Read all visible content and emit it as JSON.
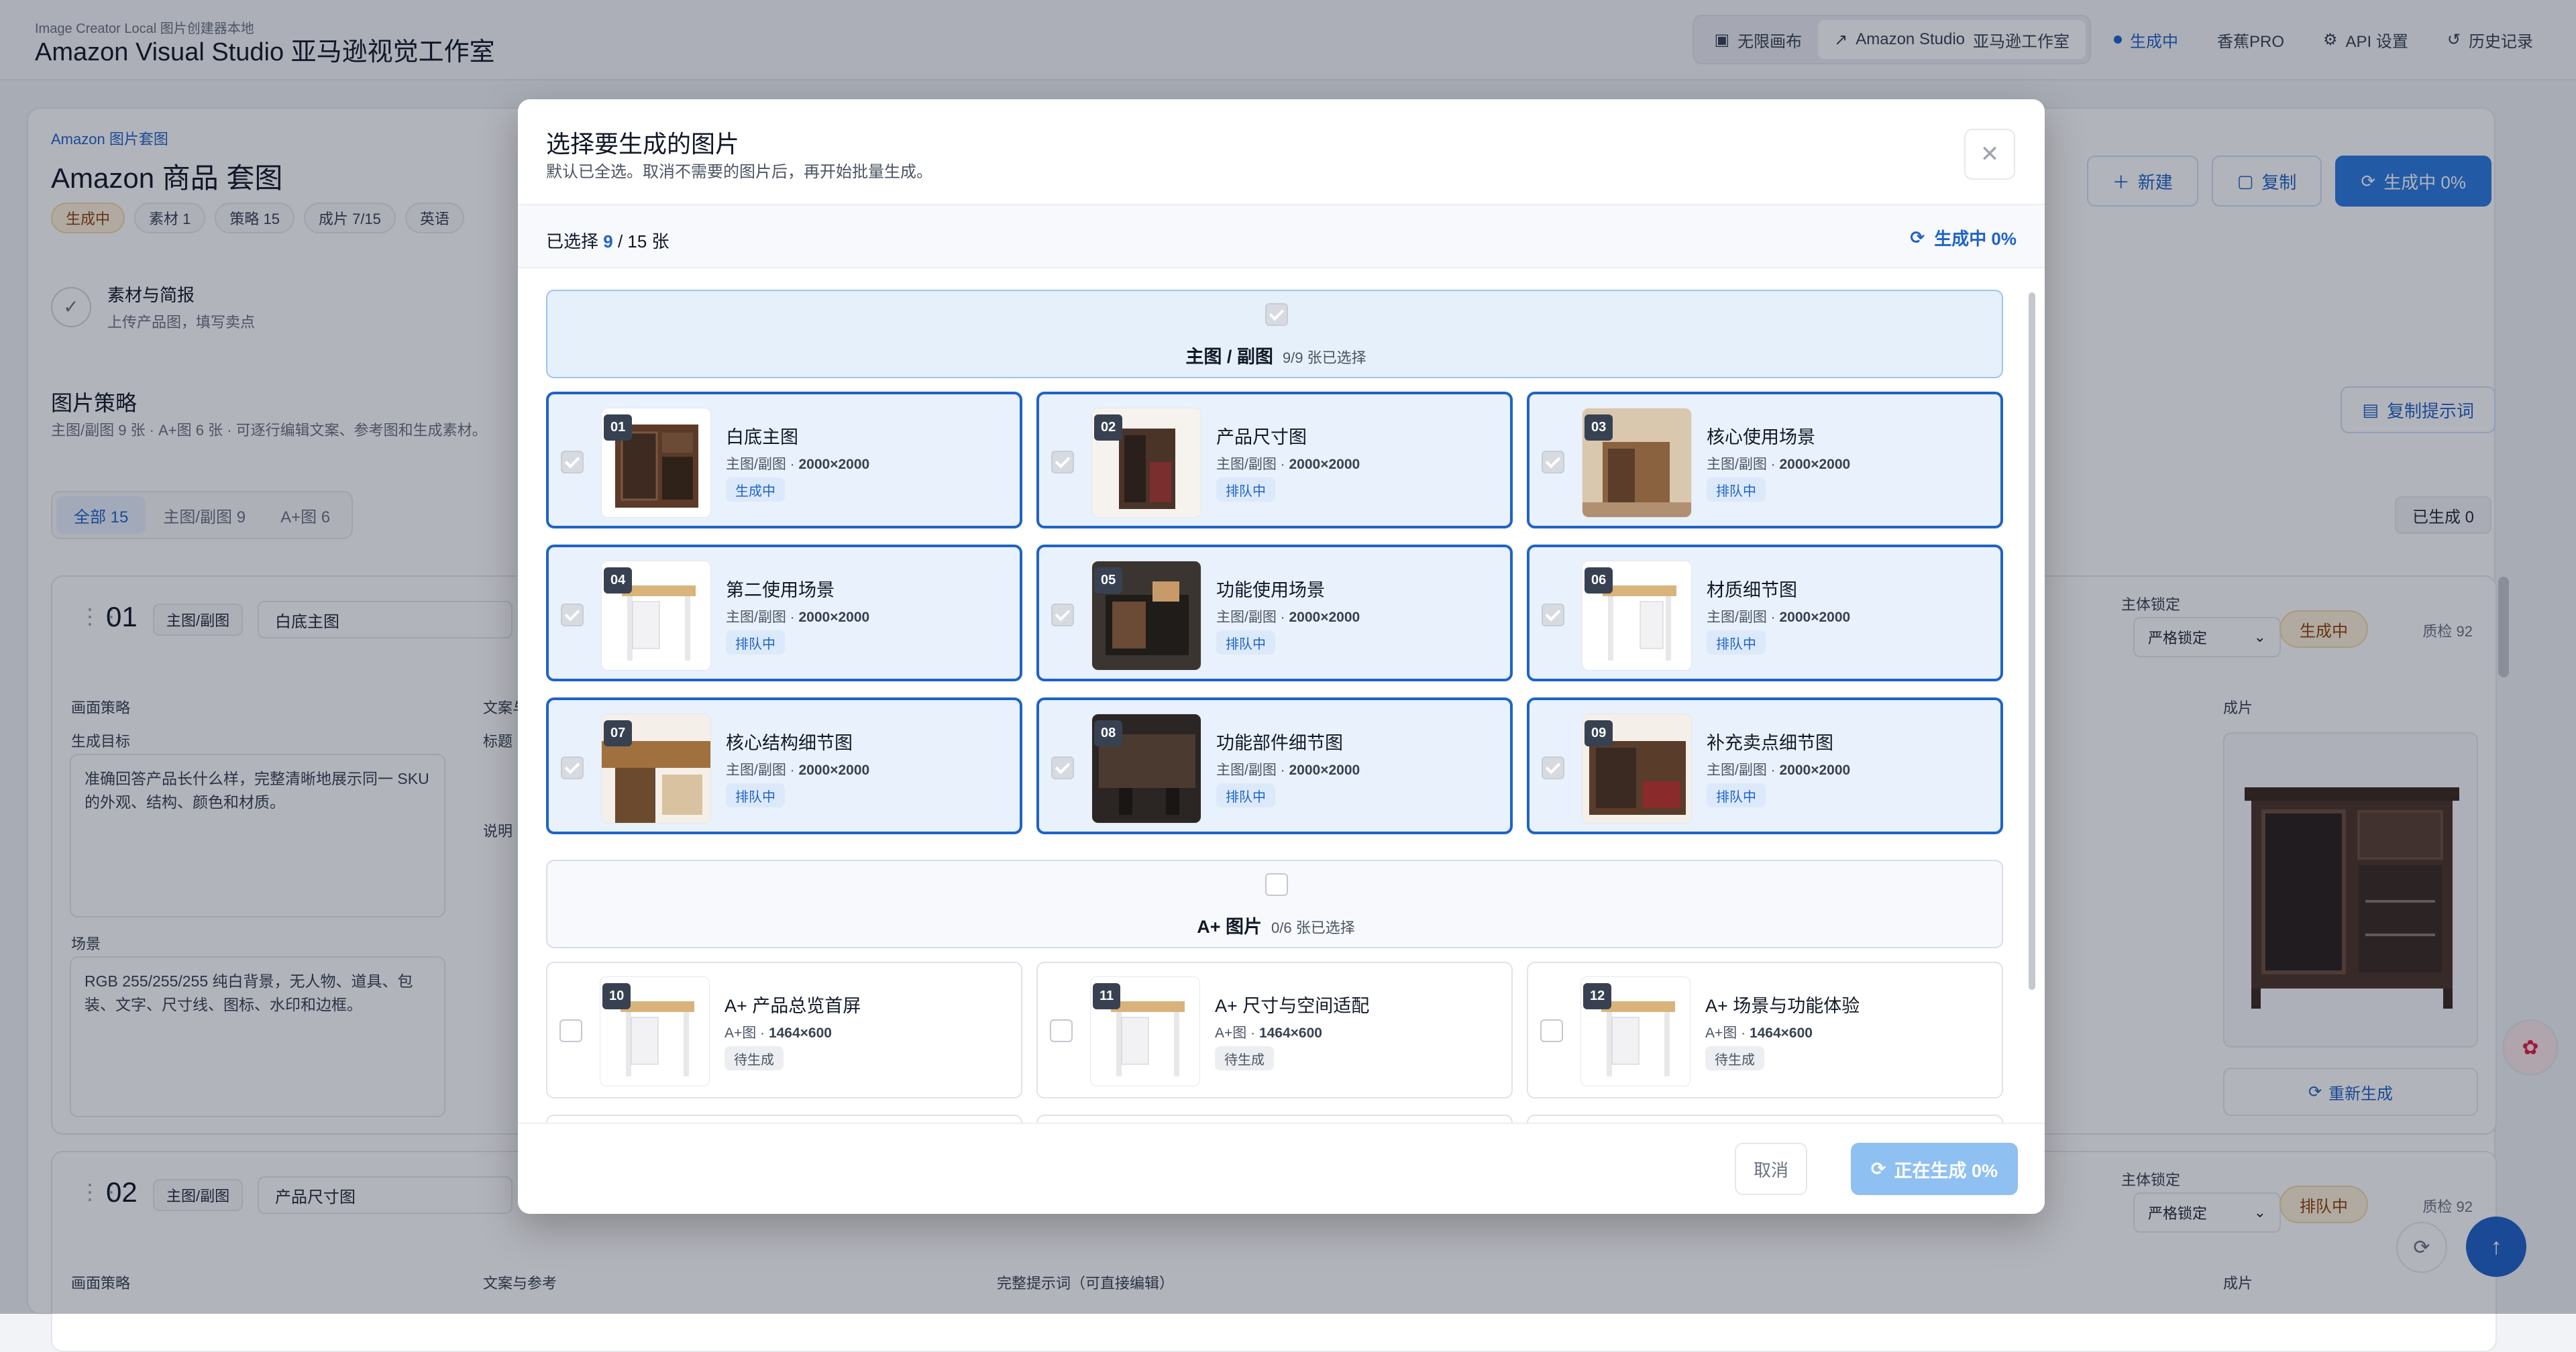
{
  "app": {
    "subtitle": "Image Creator Local 图片创建器本地",
    "title": "Amazon Visual Studio 亚马逊视觉工作室",
    "nav": {
      "canvas": "无限画布",
      "studio": "Amazon Studio",
      "studio_cn": "亚马逊工作室",
      "generating": "生成中",
      "banana": "香蕉PRO",
      "api": "API 设置",
      "history": "历史记录"
    }
  },
  "page": {
    "crumb": "Amazon 图片套图",
    "title": "Amazon 商品 套图",
    "chips": [
      "生成中",
      "素材 1",
      "策略 15",
      "成片 7/15",
      "英语"
    ],
    "buttons": {
      "new": "新建",
      "copy": "复制",
      "generating": "生成中 0%"
    },
    "step": {
      "title": "素材与简报",
      "sub": "上传产品图，填写卖点"
    },
    "strategy": {
      "title": "图片策略",
      "sub": "主图/副图 9 张 · A+图 6 张 · 可逐行编辑文案、参考图和生成素材。",
      "copy_prompt": "复制提示词",
      "filters": [
        "全部 15",
        "主图/副图 9",
        "A+图 6"
      ],
      "done": "已生成 0"
    },
    "cards": [
      {
        "num": "01",
        "tag": "主图/副图",
        "name": "白底主图",
        "lock_label": "主体锁定",
        "lock_value": "严格锁定",
        "status": "生成中",
        "qc": "质检 92"
      },
      {
        "num": "02",
        "tag": "主图/副图",
        "name": "产品尺寸图",
        "lock_label": "主体锁定",
        "lock_value": "严格锁定",
        "status": "排队中",
        "qc": "质检 92"
      }
    ],
    "card_fields": {
      "strategy": "画面策略",
      "goal": "生成目标",
      "goal_text": "准确回答产品长什么样，完整清晰地展示同一 SKU 的外观、结构、颜色和材质。",
      "scene": "场景",
      "scene_text": "RGB 255/255/255 纯白背景，无人物、道具、包装、文字、尺寸线、图标、水印和边框。",
      "copy_ref": "文案与参考",
      "title_lbl": "标题",
      "desc_lbl": "说明",
      "output": "成片",
      "regen": "重新生成",
      "full_prompt": "完整提示词（可直接编辑）"
    }
  },
  "modal": {
    "title": "选择要生成的图片",
    "subtitle": "默认已全选。取消不需要的图片后，再开始批量生成。",
    "selected_prefix": "已选择",
    "selected": "9",
    "total": "/ 15 张",
    "progress": "生成中 0%",
    "groups": [
      {
        "label": "主图 / 副图",
        "count": "9/9 张已选择",
        "items": [
          {
            "no": "01",
            "name": "白底主图",
            "meta_type": "主图/副图 · ",
            "size": "2000×2000",
            "status": "生成中",
            "selected": true
          },
          {
            "no": "02",
            "name": "产品尺寸图",
            "meta_type": "主图/副图 · ",
            "size": "2000×2000",
            "status": "排队中",
            "selected": true
          },
          {
            "no": "03",
            "name": "核心使用场景",
            "meta_type": "主图/副图 · ",
            "size": "2000×2000",
            "status": "排队中",
            "selected": true
          },
          {
            "no": "04",
            "name": "第二使用场景",
            "meta_type": "主图/副图 · ",
            "size": "2000×2000",
            "status": "排队中",
            "selected": true
          },
          {
            "no": "05",
            "name": "功能使用场景",
            "meta_type": "主图/副图 · ",
            "size": "2000×2000",
            "status": "排队中",
            "selected": true
          },
          {
            "no": "06",
            "name": "材质细节图",
            "meta_type": "主图/副图 · ",
            "size": "2000×2000",
            "status": "排队中",
            "selected": true
          },
          {
            "no": "07",
            "name": "核心结构细节图",
            "meta_type": "主图/副图 · ",
            "size": "2000×2000",
            "status": "排队中",
            "selected": true
          },
          {
            "no": "08",
            "name": "功能部件细节图",
            "meta_type": "主图/副图 · ",
            "size": "2000×2000",
            "status": "排队中",
            "selected": true
          },
          {
            "no": "09",
            "name": "补充卖点细节图",
            "meta_type": "主图/副图 · ",
            "size": "2000×2000",
            "status": "排队中",
            "selected": true
          }
        ]
      },
      {
        "label": "A+ 图片",
        "count": "0/6 张已选择",
        "items": [
          {
            "no": "10",
            "name": "A+ 产品总览首屏",
            "meta_type": "A+图 · ",
            "size": "1464×600",
            "status": "待生成",
            "selected": false
          },
          {
            "no": "11",
            "name": "A+ 尺寸与空间适配",
            "meta_type": "A+图 · ",
            "size": "1464×600",
            "status": "待生成",
            "selected": false
          },
          {
            "no": "12",
            "name": "A+ 场景与功能体验",
            "meta_type": "A+图 · ",
            "size": "1464×600",
            "status": "待生成",
            "selected": false
          }
        ]
      }
    ],
    "cancel": "取消",
    "submit": "正在生成 0%"
  }
}
